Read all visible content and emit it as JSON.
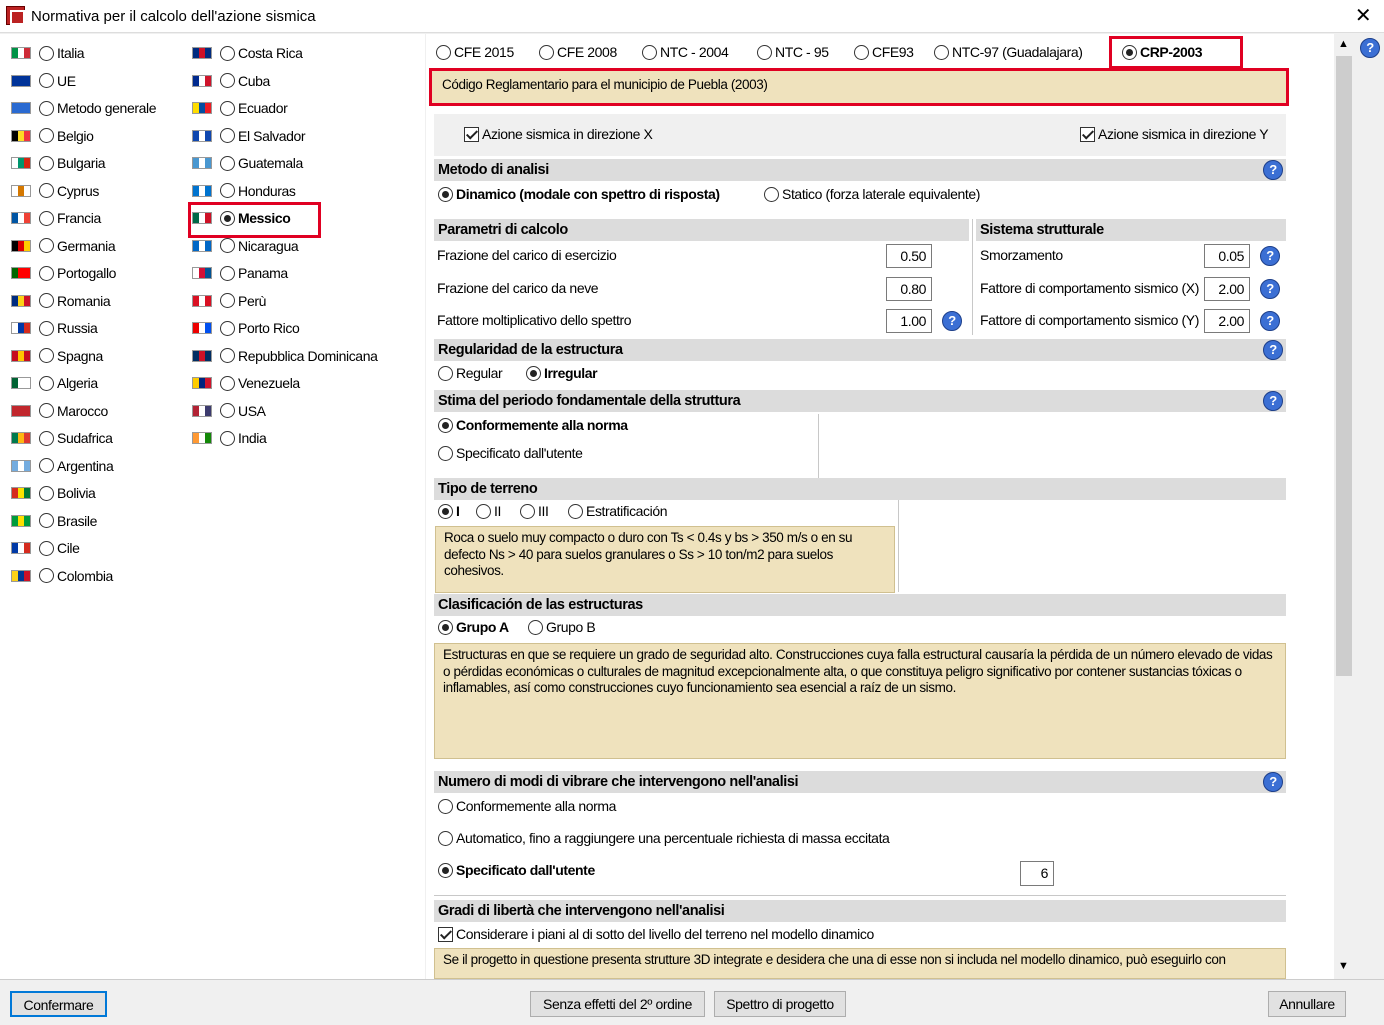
{
  "window": {
    "title": "Normativa per il calcolo dell'azione sismica",
    "close": "✕"
  },
  "countries_col1": [
    {
      "label": "Italia",
      "flag": [
        "#009246",
        "#ffffff",
        "#ce2b37"
      ]
    },
    {
      "label": "UE",
      "flag": [
        "#003399",
        "#003399",
        "#003399"
      ]
    },
    {
      "label": "Metodo generale",
      "flag": [
        "#2a6ad1",
        "#2a6ad1",
        "#2a6ad1"
      ]
    },
    {
      "label": "Belgio",
      "flag": [
        "#000000",
        "#fdda24",
        "#ef3340"
      ]
    },
    {
      "label": "Bulgaria",
      "flag": [
        "#ffffff",
        "#00966e",
        "#d62612"
      ]
    },
    {
      "label": "Cyprus",
      "flag": [
        "#ffffff",
        "#d57800",
        "#ffffff"
      ]
    },
    {
      "label": "Francia",
      "flag": [
        "#0055a4",
        "#ffffff",
        "#ef4135"
      ]
    },
    {
      "label": "Germania",
      "flag": [
        "#000000",
        "#dd0000",
        "#ffce00"
      ]
    },
    {
      "label": "Portogallo",
      "flag": [
        "#006600",
        "#ff0000",
        "#ff0000"
      ]
    },
    {
      "label": "Romania",
      "flag": [
        "#002b7f",
        "#fcd116",
        "#ce1126"
      ]
    },
    {
      "label": "Russia",
      "flag": [
        "#ffffff",
        "#0039a6",
        "#d52b1e"
      ]
    },
    {
      "label": "Spagna",
      "flag": [
        "#c60b1e",
        "#ffc400",
        "#c60b1e"
      ]
    },
    {
      "label": "Algeria",
      "flag": [
        "#006233",
        "#ffffff",
        "#ffffff"
      ]
    },
    {
      "label": "Marocco",
      "flag": [
        "#c1272d",
        "#c1272d",
        "#c1272d"
      ]
    },
    {
      "label": "Sudafrica",
      "flag": [
        "#007a4d",
        "#ffb612",
        "#de3831"
      ]
    },
    {
      "label": "Argentina",
      "flag": [
        "#74acdf",
        "#ffffff",
        "#74acdf"
      ]
    },
    {
      "label": "Bolivia",
      "flag": [
        "#d52b1e",
        "#f9e300",
        "#007934"
      ]
    },
    {
      "label": "Brasile",
      "flag": [
        "#009c3b",
        "#ffdf00",
        "#009c3b"
      ]
    },
    {
      "label": "Cile",
      "flag": [
        "#0039a6",
        "#ffffff",
        "#d52b1e"
      ]
    },
    {
      "label": "Colombia",
      "flag": [
        "#fcd116",
        "#003893",
        "#ce1126"
      ]
    }
  ],
  "countries_col2": [
    {
      "label": "Costa Rica",
      "flag": [
        "#002b7f",
        "#ce1126",
        "#002b7f"
      ]
    },
    {
      "label": "Cuba",
      "flag": [
        "#002a8f",
        "#ffffff",
        "#cf142b"
      ]
    },
    {
      "label": "Ecuador",
      "flag": [
        "#ffdd00",
        "#034ea2",
        "#ed1c24"
      ]
    },
    {
      "label": "El Salvador",
      "flag": [
        "#0f47af",
        "#ffffff",
        "#0f47af"
      ]
    },
    {
      "label": "Guatemala",
      "flag": [
        "#4997d0",
        "#ffffff",
        "#4997d0"
      ]
    },
    {
      "label": "Honduras",
      "flag": [
        "#0073cf",
        "#ffffff",
        "#0073cf"
      ]
    },
    {
      "label": "Messico",
      "flag": [
        "#006847",
        "#ffffff",
        "#ce1126"
      ]
    },
    {
      "label": "Nicaragua",
      "flag": [
        "#0067c6",
        "#ffffff",
        "#0067c6"
      ]
    },
    {
      "label": "Panama",
      "flag": [
        "#ffffff",
        "#d21034",
        "#005293"
      ]
    },
    {
      "label": "Perù",
      "flag": [
        "#d91023",
        "#ffffff",
        "#d91023"
      ]
    },
    {
      "label": "Porto Rico",
      "flag": [
        "#ed0000",
        "#ffffff",
        "#0050f0"
      ]
    },
    {
      "label": "Repubblica Dominicana",
      "flag": [
        "#002d62",
        "#ce1126",
        "#002d62"
      ]
    },
    {
      "label": "Venezuela",
      "flag": [
        "#ffcc00",
        "#00247d",
        "#cf142b"
      ]
    },
    {
      "label": "USA",
      "flag": [
        "#b22234",
        "#ffffff",
        "#3c3b6e"
      ]
    },
    {
      "label": "India",
      "flag": [
        "#ff9933",
        "#ffffff",
        "#138808"
      ]
    }
  ],
  "selected_country": "Messico",
  "norms": [
    {
      "label": "CFE 2015"
    },
    {
      "label": "CFE 2008"
    },
    {
      "label": "NTC - 2004"
    },
    {
      "label": "NTC - 95"
    },
    {
      "label": "CFE93"
    },
    {
      "label": "NTC-97 (Guadalajara)"
    },
    {
      "label": "CRP-2003"
    }
  ],
  "selected_norm": "CRP-2003",
  "norm_description": "Código Reglamentario para el municipio de Puebla (2003)",
  "seismic_x": "Azione sismica in direzione X",
  "seismic_y": "Azione sismica in direzione Y",
  "analysis": {
    "title": "Metodo di analisi",
    "dynamic": "Dinamico (modale con spettro di risposta)",
    "static": "Statico (forza laterale equivalente)"
  },
  "calc": {
    "title": "Parametri di calcolo",
    "rows": [
      {
        "label": "Frazione del carico di esercizio",
        "value": "0.50"
      },
      {
        "label": "Frazione del carico da neve",
        "value": "0.80"
      },
      {
        "label": "Fattore moltiplicativo dello spettro",
        "value": "1.00"
      }
    ]
  },
  "system": {
    "title": "Sistema strutturale",
    "rows": [
      {
        "label": "Smorzamento",
        "value": "0.05"
      },
      {
        "label": "Fattore di comportamento sismico (X)",
        "value": "2.00"
      },
      {
        "label": "Fattore di comportamento sismico (Y)",
        "value": "2.00"
      }
    ]
  },
  "regularity": {
    "title": "Regularidad de la estructura",
    "regular": "Regular",
    "irregular": "Irregular"
  },
  "period": {
    "title": "Stima del periodo fondamentale della struttura",
    "norm": "Conformemente alla norma",
    "user": "Specificato dall'utente"
  },
  "soil": {
    "title": "Tipo de terreno",
    "options": [
      "I",
      "II",
      "III",
      "Estratificación"
    ],
    "note": "Roca o suelo muy compacto o duro con Ts < 0.4s y bs > 350 m/s o en su defecto Ns > 40 para suelos granulares o Ss > 10 ton/m2 para suelos cohesivos."
  },
  "classification": {
    "title": "Clasificación de las estructuras",
    "a": "Grupo A",
    "b": "Grupo B",
    "note": "Estructuras en que se requiere un grado de seguridad alto. Construcciones cuya falla estructural causaría la pérdida de un número elevado de vidas o pérdidas económicas o culturales de magnitud excepcionalmente alta, o que constituya peligro significativo por contener sustancias tóxicas o inflamables, así como construcciones cuyo funcionamiento sea esencial a raíz de un sismo."
  },
  "modes": {
    "title": "Numero di modi di vibrare che intervengono nell'analisi",
    "norm": "Conformemente alla norma",
    "auto": "Automatico, fino a raggiungere una percentuale richiesta di massa eccitata",
    "user": "Specificato dall'utente",
    "value": "6"
  },
  "dof": {
    "title": "Gradi di libertà che intervengono nell'analisi",
    "check": "Considerare i piani al di sotto del livello del terreno nel modello dinamico",
    "note": "Se il progetto in questione presenta strutture 3D integrate e desidera che una di esse non si includa nel modello dinamico, può eseguirlo con"
  },
  "help": "?",
  "buttons": {
    "confirm": "Confermare",
    "second_order": "Senza effetti del 2º ordine",
    "spectrum": "Spettro di progetto",
    "cancel": "Annullare"
  }
}
